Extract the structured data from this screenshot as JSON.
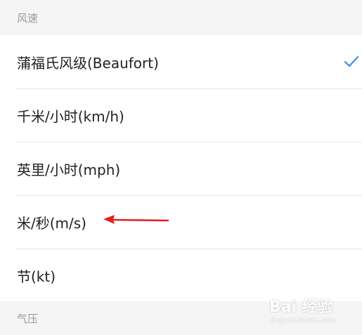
{
  "sections": {
    "wind_speed": {
      "title": "风速",
      "items": [
        {
          "label": "蒲福氏风级(Beaufort)",
          "selected": true
        },
        {
          "label": "千米/小时(km/h)",
          "selected": false
        },
        {
          "label": "英里/小时(mph)",
          "selected": false
        },
        {
          "label": "米/秒(m/s)",
          "selected": false
        },
        {
          "label": "节(kt)",
          "selected": false
        }
      ]
    },
    "pressure": {
      "title": "气压"
    }
  },
  "colors": {
    "accent_check": "#3d8fe6",
    "annotation_arrow": "#e02020"
  },
  "icons": {
    "selected": "check-icon",
    "annotation": "arrow-left-icon"
  },
  "watermark": {
    "brand": "Bai 经验",
    "url": "jingyan.baidu.com"
  }
}
